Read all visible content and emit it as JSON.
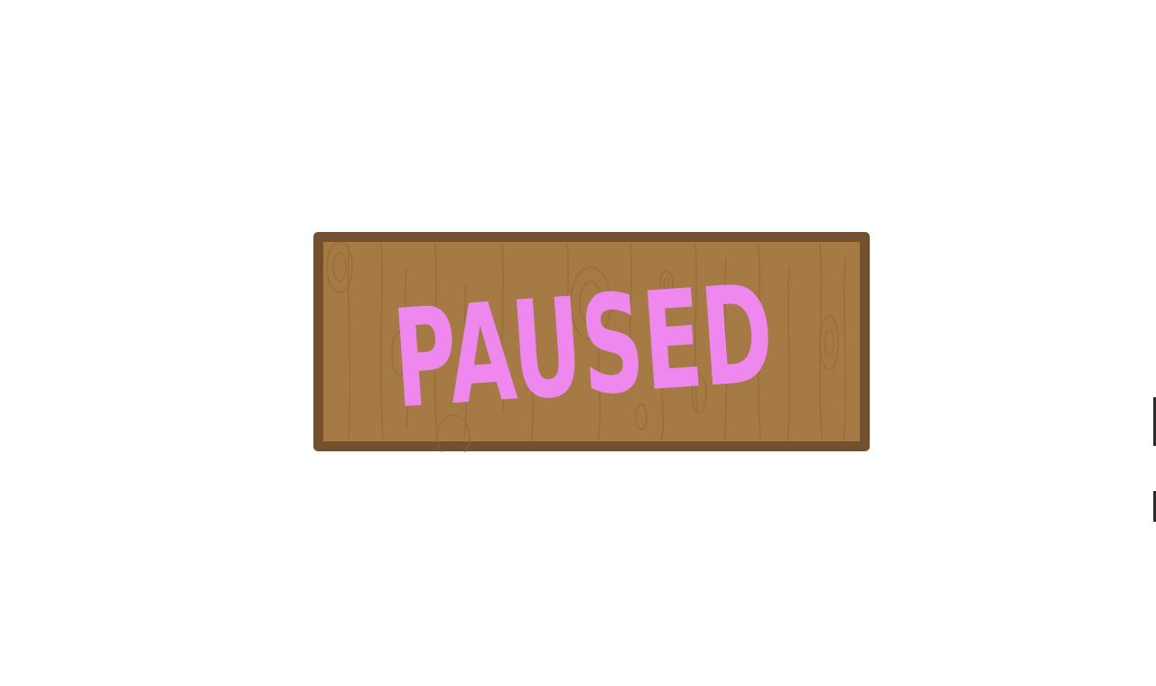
{
  "pause_sign": {
    "text": "PAUSED",
    "text_color": "#ee88ee",
    "wood_color": "#a57a45",
    "frame_color": "#74512e",
    "grain_color": "#8f6535"
  },
  "background_color": "#ffffff"
}
